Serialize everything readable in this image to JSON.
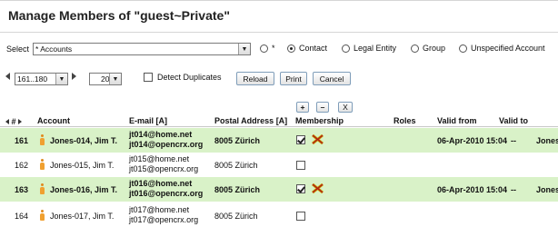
{
  "page_title": "Manage Members of \"guest~Private\"",
  "selector": {
    "label": "Select",
    "value": "* Accounts",
    "radios": [
      {
        "label": "*",
        "checked": false
      },
      {
        "label": "Contact",
        "checked": true
      },
      {
        "label": "Legal Entity",
        "checked": false
      },
      {
        "label": "Group",
        "checked": false
      },
      {
        "label": "Unspecified Account",
        "checked": false
      }
    ]
  },
  "pager": {
    "range": "161..180",
    "page_size": "20",
    "detect_duplicates_label": "Detect Duplicates",
    "detect_duplicates_checked": false,
    "reload_label": "Reload",
    "print_label": "Print",
    "cancel_label": "Cancel"
  },
  "membership_buttons": {
    "add": "+",
    "remove": "–",
    "clear": "X"
  },
  "columns": {
    "nav": "#",
    "account": "Account",
    "email": "E-mail [A]",
    "postal": "Postal Address [A]",
    "membership": "Membership",
    "roles": "Roles",
    "valid_from": "Valid from",
    "valid_to": "Valid to"
  },
  "rows": [
    {
      "num": "161",
      "name": "Jones-014, Jim T.",
      "email1": "jt014@home.net",
      "email2": "jt014@opencrx.org",
      "postal": "8005 Zürich",
      "member": true,
      "valid_from": "06-Apr-2010 15:04",
      "valid_to": "--",
      "extra": "Jones"
    },
    {
      "num": "162",
      "name": "Jones-015, Jim T.",
      "email1": "jt015@home.net",
      "email2": "jt015@opencrx.org",
      "postal": "8005 Zürich",
      "member": false,
      "valid_from": "",
      "valid_to": "",
      "extra": ""
    },
    {
      "num": "163",
      "name": "Jones-016, Jim T.",
      "email1": "jt016@home.net",
      "email2": "jt016@opencrx.org",
      "postal": "8005 Zürich",
      "member": true,
      "valid_from": "06-Apr-2010 15:04",
      "valid_to": "--",
      "extra": "Jones"
    },
    {
      "num": "164",
      "name": "Jones-017, Jim T.",
      "email1": "jt017@home.net",
      "email2": "jt017@opencrx.org",
      "postal": "8005 Zürich",
      "member": false,
      "valid_from": "",
      "valid_to": "",
      "extra": ""
    }
  ]
}
